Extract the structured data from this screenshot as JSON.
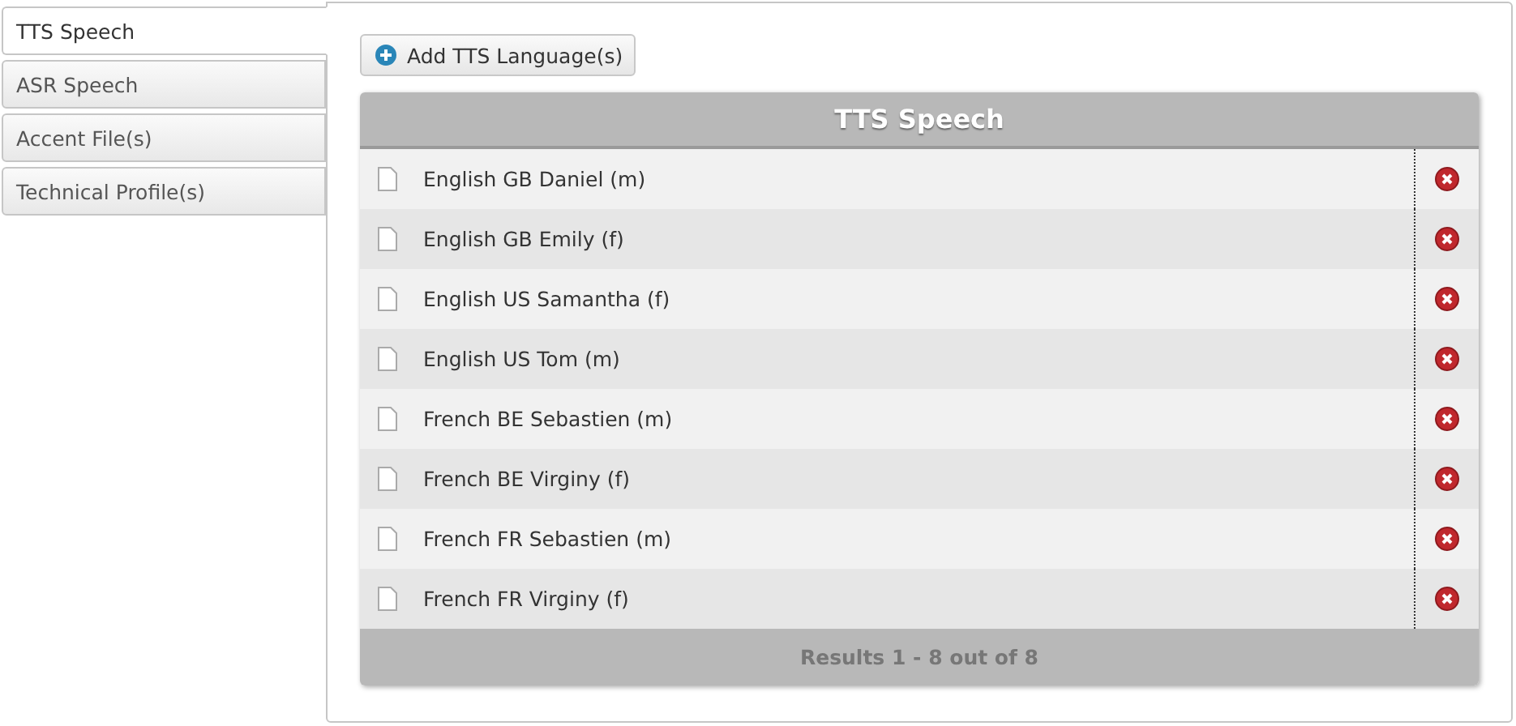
{
  "tabs": [
    {
      "label": "TTS Speech",
      "selected": true
    },
    {
      "label": "ASR Speech",
      "selected": false
    },
    {
      "label": "Accent File(s)",
      "selected": false
    },
    {
      "label": "Technical Profile(s)",
      "selected": false
    }
  ],
  "add_button": "Add TTS Language(s)",
  "table": {
    "title": "TTS Speech",
    "rows": [
      {
        "name": "English GB Daniel (m)"
      },
      {
        "name": "English GB Emily (f)"
      },
      {
        "name": "English US Samantha (f)"
      },
      {
        "name": "English US Tom (m)"
      },
      {
        "name": "French BE Sebastien (m)"
      },
      {
        "name": "French BE Virginy (f)"
      },
      {
        "name": "French FR Sebastien (m)"
      },
      {
        "name": "French FR Virginy (f)"
      }
    ],
    "footer": "Results 1 - 8 out of 8"
  }
}
